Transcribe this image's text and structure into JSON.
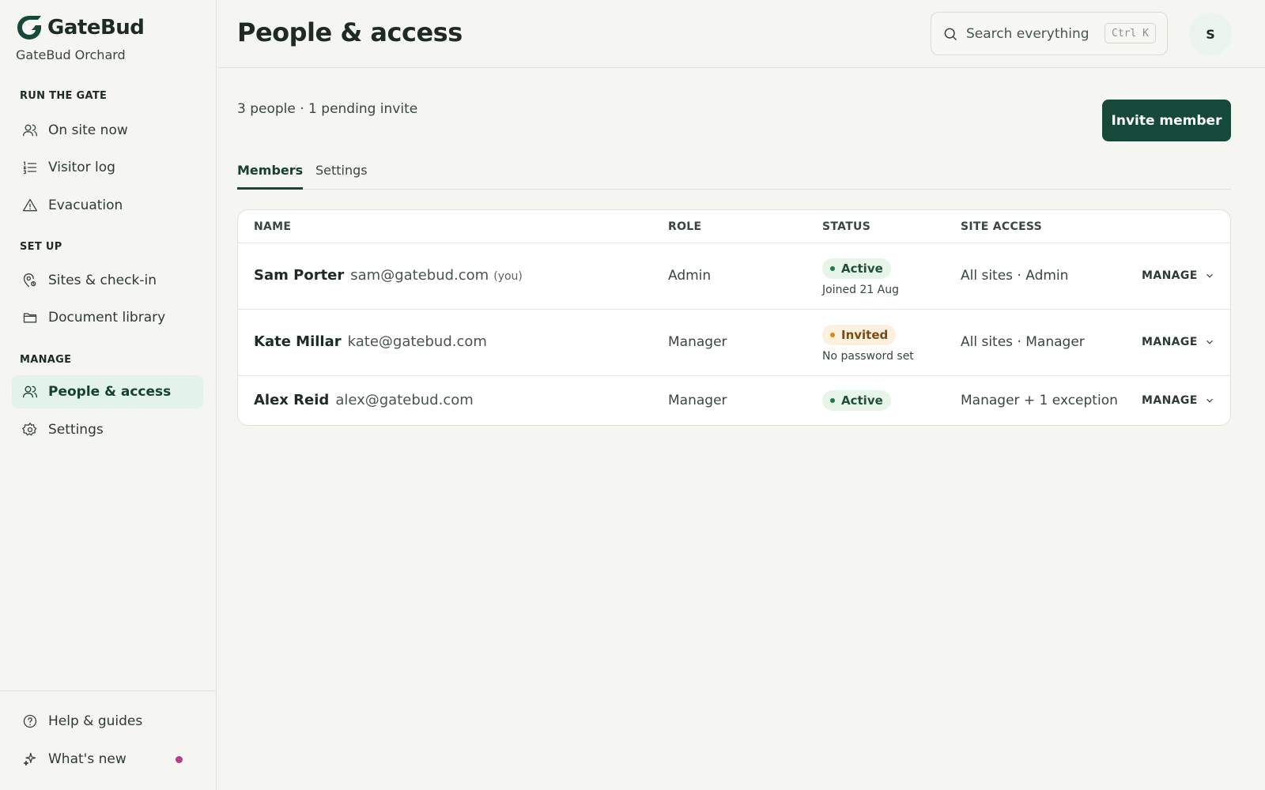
{
  "brand": {
    "name": "GateBud",
    "org": "GateBud Orchard",
    "accent": "#17493a"
  },
  "sidebar": {
    "sections": [
      {
        "label": "RUN THE GATE"
      },
      {
        "label": "SET UP"
      },
      {
        "label": "MANAGE"
      }
    ],
    "items": [
      {
        "label": "On site now",
        "icon": "users-icon"
      },
      {
        "label": "Visitor log",
        "icon": "list-icon"
      },
      {
        "label": "Evacuation",
        "icon": "warning-icon"
      },
      {
        "label": "Sites & check-in",
        "icon": "location-icon"
      },
      {
        "label": "Document library",
        "icon": "folder-icon"
      },
      {
        "label": "People & access",
        "icon": "people-icon",
        "active": true
      },
      {
        "label": "Settings",
        "icon": "gear-icon"
      }
    ],
    "bottom": [
      {
        "label": "Help & guides",
        "icon": "help-icon"
      },
      {
        "label": "What's new",
        "icon": "sparkle-icon",
        "has_dot": true
      }
    ]
  },
  "header": {
    "title": "People & access",
    "search_placeholder": "Search everything",
    "shortcut": "Ctrl K",
    "avatar_initial": "S"
  },
  "main": {
    "summary": "3 people · 1 pending invite",
    "invite_label": "Invite member",
    "tabs": [
      {
        "label": "Members",
        "active": true
      },
      {
        "label": "Settings"
      }
    ],
    "table": {
      "columns": [
        "NAME",
        "ROLE",
        "STATUS",
        "SITE ACCESS"
      ],
      "manage_label": "MANAGE",
      "rows": [
        {
          "name": "Sam Porter",
          "email": "sam@gatebud.com",
          "you": "(you)",
          "role": "Admin",
          "status": "Active",
          "status_sub": "Joined 21 Aug",
          "access": "All sites · Admin"
        },
        {
          "name": "Kate Millar",
          "email": "kate@gatebud.com",
          "role": "Manager",
          "status": "Invited",
          "status_sub": "No password set",
          "access": "All sites · Manager"
        },
        {
          "name": "Alex Reid",
          "email": "alex@gatebud.com",
          "role": "Manager",
          "status": "Active",
          "access": "Manager + 1 exception"
        }
      ]
    }
  }
}
